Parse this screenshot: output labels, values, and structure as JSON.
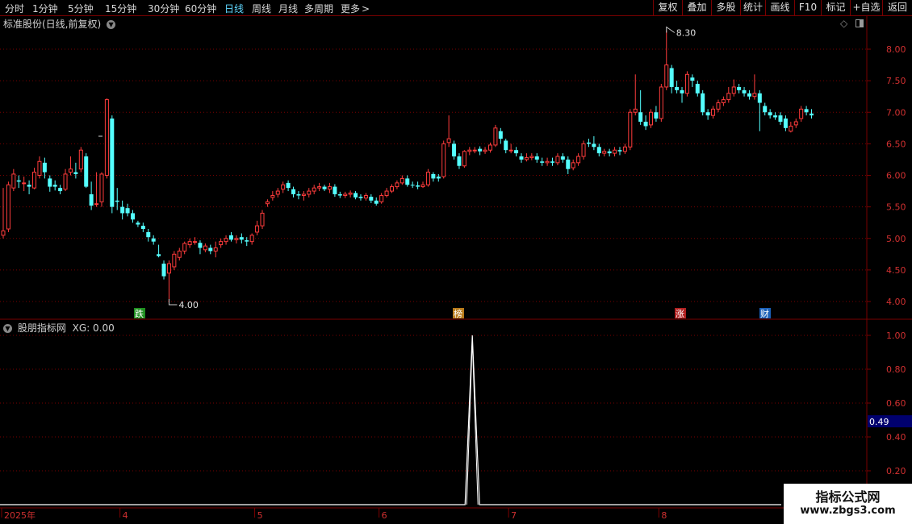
{
  "toolbar": {
    "periods": [
      "分时",
      "1分钟",
      "5分钟",
      "15分钟",
      "30分钟",
      "60分钟",
      "日线",
      "周线",
      "月线",
      "多周期",
      "更多"
    ],
    "active_period": "日线",
    "more_glyph": ">",
    "right_buttons": [
      "复权",
      "叠加",
      "多股",
      "统计",
      "画线",
      "F10",
      "+自选",
      "返回"
    ]
  },
  "main_panel": {
    "title": "标准股份(日线,前复权)",
    "high_marker": "8.30",
    "low_marker": "4.00",
    "event_labels": [
      "跌",
      "榜",
      "涨",
      "财"
    ]
  },
  "indicator_panel": {
    "title": "股朋指标网",
    "xg_label": "XG: 0.00",
    "cursor_value": "0.49"
  },
  "watermark": {
    "title": "指标公式网",
    "url": "www.zbgs3.com"
  },
  "colors": {
    "up": "#ff3c3c",
    "down": "#54ffff",
    "grid": "#7a0000",
    "axis_text": "#d03030",
    "date_text": "#d03030",
    "indicator_line": "#ffffff",
    "cursor_box": "#00006e"
  },
  "chart_data": [
    {
      "type": "candlestick",
      "title": "标准股份(日线,前复权)",
      "y_ticks": [
        "8.00",
        "7.50",
        "7.00",
        "6.50",
        "6.00",
        "5.50",
        "5.00",
        "4.50",
        "4.00"
      ],
      "ylim": [
        3.85,
        8.4
      ],
      "x_ticks": [
        "2025年",
        "4",
        "5",
        "6",
        "7",
        "8"
      ],
      "annotations": {
        "high": 8.3,
        "low": 4.0
      },
      "candles": [
        [
          5.05,
          5.12,
          5.0,
          5.8
        ],
        [
          5.15,
          5.85,
          5.1,
          5.9
        ],
        [
          5.8,
          6.02,
          5.75,
          6.1
        ],
        [
          5.92,
          5.9,
          5.8,
          6.0
        ],
        [
          5.88,
          5.88,
          5.75,
          5.98
        ],
        [
          5.85,
          5.82,
          5.7,
          5.92
        ],
        [
          5.8,
          6.05,
          5.78,
          6.12
        ],
        [
          6.0,
          6.22,
          5.95,
          6.3
        ],
        [
          6.2,
          6.05,
          5.95,
          6.28
        ],
        [
          5.95,
          5.82,
          5.74,
          6.0
        ],
        [
          5.85,
          5.82,
          5.76,
          5.92
        ],
        [
          5.8,
          5.75,
          5.7,
          5.85
        ],
        [
          5.78,
          6.02,
          5.75,
          6.1
        ],
        [
          6.05,
          6.1,
          6.0,
          6.3
        ],
        [
          6.05,
          6.02,
          5.95,
          6.2
        ],
        [
          6.1,
          6.4,
          6.05,
          6.45
        ],
        [
          6.3,
          5.82,
          5.8,
          6.35
        ],
        [
          5.7,
          5.52,
          5.45,
          5.9
        ],
        [
          5.55,
          5.55,
          5.5,
          6.05
        ],
        [
          5.58,
          6.02,
          5.5,
          6.05
        ],
        [
          6.0,
          7.2,
          5.95,
          7.22
        ],
        [
          6.9,
          5.5,
          5.4,
          6.95
        ],
        [
          5.6,
          5.58,
          5.45,
          5.8
        ],
        [
          5.5,
          5.4,
          5.3,
          5.6
        ],
        [
          5.48,
          5.4,
          5.35,
          5.55
        ],
        [
          5.4,
          5.3,
          5.25,
          5.45
        ],
        [
          5.25,
          5.22,
          5.18,
          5.28
        ],
        [
          5.2,
          5.15,
          5.1,
          5.25
        ],
        [
          5.1,
          5.02,
          4.95,
          5.15
        ],
        [
          5.0,
          4.95,
          4.9,
          5.05
        ],
        [
          4.75,
          4.72,
          4.7,
          4.9
        ],
        [
          4.6,
          4.4,
          4.35,
          4.65
        ],
        [
          4.45,
          4.6,
          4.0,
          4.65
        ],
        [
          4.55,
          4.75,
          4.5,
          4.8
        ],
        [
          4.7,
          4.8,
          4.65,
          4.85
        ],
        [
          4.8,
          4.92,
          4.75,
          4.95
        ],
        [
          4.9,
          4.95,
          4.85,
          5.0
        ],
        [
          4.95,
          4.95,
          4.9,
          5.02
        ],
        [
          4.93,
          4.85,
          4.75,
          4.97
        ],
        [
          4.82,
          4.88,
          4.78,
          4.92
        ],
        [
          4.85,
          4.8,
          4.75,
          4.9
        ],
        [
          4.8,
          4.85,
          4.7,
          4.95
        ],
        [
          4.9,
          4.95,
          4.85,
          5.0
        ],
        [
          4.95,
          5.0,
          4.9,
          5.05
        ],
        [
          5.05,
          4.98,
          4.95,
          5.1
        ],
        [
          4.98,
          5.0,
          4.92,
          5.05
        ],
        [
          5.02,
          4.98,
          4.92,
          5.08
        ],
        [
          4.97,
          4.95,
          4.88,
          5.02
        ],
        [
          4.95,
          5.05,
          4.9,
          5.08
        ],
        [
          5.1,
          5.2,
          5.05,
          5.28
        ],
        [
          5.2,
          5.4,
          5.15,
          5.45
        ],
        [
          5.55,
          5.58,
          5.5,
          5.62
        ],
        [
          5.65,
          5.68,
          5.6,
          5.75
        ],
        [
          5.7,
          5.75,
          5.65,
          5.8
        ],
        [
          5.78,
          5.85,
          5.72,
          5.9
        ],
        [
          5.88,
          5.8,
          5.75,
          5.92
        ],
        [
          5.78,
          5.7,
          5.65,
          5.82
        ],
        [
          5.7,
          5.68,
          5.62,
          5.75
        ],
        [
          5.68,
          5.7,
          5.6,
          5.75
        ],
        [
          5.7,
          5.75,
          5.65,
          5.8
        ],
        [
          5.75,
          5.8,
          5.7,
          5.85
        ],
        [
          5.8,
          5.82,
          5.75,
          5.88
        ],
        [
          5.82,
          5.78,
          5.75,
          5.85
        ],
        [
          5.78,
          5.82,
          5.72,
          5.88
        ],
        [
          5.82,
          5.7,
          5.66,
          5.86
        ],
        [
          5.7,
          5.68,
          5.64,
          5.74
        ],
        [
          5.68,
          5.7,
          5.64,
          5.74
        ],
        [
          5.7,
          5.72,
          5.65,
          5.76
        ],
        [
          5.72,
          5.65,
          5.62,
          5.75
        ],
        [
          5.66,
          5.64,
          5.6,
          5.7
        ],
        [
          5.64,
          5.68,
          5.6,
          5.72
        ],
        [
          5.66,
          5.6,
          5.56,
          5.7
        ],
        [
          5.6,
          5.55,
          5.52,
          5.65
        ],
        [
          5.58,
          5.68,
          5.55,
          5.72
        ],
        [
          5.68,
          5.75,
          5.65,
          5.8
        ],
        [
          5.75,
          5.82,
          5.72,
          5.86
        ],
        [
          5.82,
          5.88,
          5.78,
          5.92
        ],
        [
          5.88,
          5.95,
          5.85,
          6.0
        ],
        [
          5.95,
          5.85,
          5.82,
          6.0
        ],
        [
          5.85,
          5.84,
          5.8,
          5.9
        ],
        [
          5.84,
          5.82,
          5.78,
          5.9
        ],
        [
          5.82,
          5.85,
          5.8,
          5.9
        ],
        [
          5.85,
          6.05,
          5.82,
          6.1
        ],
        [
          6.02,
          5.95,
          5.9,
          6.05
        ],
        [
          5.98,
          5.95,
          5.9,
          6.02
        ],
        [
          5.98,
          6.5,
          5.95,
          6.55
        ],
        [
          6.52,
          6.58,
          6.45,
          6.95
        ],
        [
          6.5,
          6.3,
          6.25,
          6.55
        ],
        [
          6.3,
          6.15,
          6.1,
          6.35
        ],
        [
          6.15,
          6.38,
          6.12,
          6.4
        ],
        [
          6.38,
          6.4,
          6.32,
          6.45
        ],
        [
          6.4,
          6.4,
          6.35,
          6.45
        ],
        [
          6.42,
          6.38,
          6.32,
          6.46
        ],
        [
          6.38,
          6.4,
          6.34,
          6.45
        ],
        [
          6.4,
          6.48,
          6.36,
          6.52
        ],
        [
          6.48,
          6.75,
          6.45,
          6.8
        ],
        [
          6.7,
          6.58,
          6.5,
          6.75
        ],
        [
          6.55,
          6.4,
          6.35,
          6.58
        ],
        [
          6.4,
          6.4,
          6.35,
          6.5
        ],
        [
          6.4,
          6.35,
          6.3,
          6.45
        ],
        [
          6.3,
          6.25,
          6.2,
          6.35
        ],
        [
          6.25,
          6.28,
          6.22,
          6.35
        ],
        [
          6.28,
          6.3,
          6.24,
          6.35
        ],
        [
          6.3,
          6.25,
          6.2,
          6.35
        ],
        [
          6.22,
          6.2,
          6.15,
          6.28
        ],
        [
          6.2,
          6.22,
          6.15,
          6.28
        ],
        [
          6.22,
          6.2,
          6.15,
          6.28
        ],
        [
          6.2,
          6.3,
          6.16,
          6.35
        ],
        [
          6.3,
          6.25,
          6.2,
          6.35
        ],
        [
          6.25,
          6.1,
          6.02,
          6.3
        ],
        [
          6.12,
          6.2,
          6.08,
          6.25
        ],
        [
          6.2,
          6.3,
          6.15,
          6.35
        ],
        [
          6.3,
          6.5,
          6.25,
          6.55
        ],
        [
          6.52,
          6.5,
          6.45,
          6.58
        ],
        [
          6.5,
          6.45,
          6.4,
          6.62
        ],
        [
          6.45,
          6.35,
          6.3,
          6.5
        ],
        [
          6.35,
          6.38,
          6.3,
          6.42
        ],
        [
          6.38,
          6.35,
          6.3,
          6.42
        ],
        [
          6.35,
          6.4,
          6.3,
          6.45
        ],
        [
          6.4,
          6.38,
          6.32,
          6.45
        ],
        [
          6.38,
          6.45,
          6.34,
          6.5
        ],
        [
          6.45,
          7.0,
          6.4,
          7.05
        ],
        [
          7.0,
          7.05,
          6.95,
          7.6
        ],
        [
          7.0,
          6.85,
          6.8,
          7.35
        ],
        [
          6.85,
          6.78,
          6.72,
          6.95
        ],
        [
          6.8,
          7.0,
          6.75,
          7.05
        ],
        [
          7.0,
          6.9,
          6.85,
          7.1
        ],
        [
          6.9,
          7.4,
          6.85,
          7.45
        ],
        [
          7.4,
          7.75,
          7.35,
          8.3
        ],
        [
          7.7,
          7.4,
          7.3,
          7.75
        ],
        [
          7.4,
          7.35,
          7.3,
          7.5
        ],
        [
          7.35,
          7.3,
          7.15,
          7.4
        ],
        [
          7.3,
          7.6,
          7.25,
          7.65
        ],
        [
          7.55,
          7.5,
          7.4,
          7.6
        ],
        [
          7.45,
          7.3,
          7.25,
          7.5
        ],
        [
          7.3,
          7.0,
          6.95,
          7.35
        ],
        [
          7.0,
          6.95,
          6.88,
          7.05
        ],
        [
          6.95,
          7.05,
          6.9,
          7.1
        ],
        [
          7.05,
          7.15,
          7.0,
          7.2
        ],
        [
          7.15,
          7.2,
          7.1,
          7.25
        ],
        [
          7.2,
          7.3,
          7.15,
          7.4
        ],
        [
          7.3,
          7.4,
          7.25,
          7.52
        ],
        [
          7.4,
          7.35,
          7.3,
          7.45
        ],
        [
          7.35,
          7.3,
          7.25,
          7.4
        ],
        [
          7.3,
          7.25,
          7.2,
          7.35
        ],
        [
          7.25,
          7.3,
          7.2,
          7.6
        ],
        [
          7.3,
          7.15,
          6.7,
          7.35
        ],
        [
          7.1,
          7.0,
          6.95,
          7.15
        ],
        [
          7.0,
          6.95,
          6.9,
          7.05
        ],
        [
          6.95,
          6.92,
          6.88,
          7.0
        ],
        [
          6.95,
          6.85,
          6.8,
          7.0
        ],
        [
          6.9,
          6.75,
          6.7,
          6.95
        ],
        [
          6.7,
          6.78,
          6.68,
          6.85
        ],
        [
          6.8,
          6.85,
          6.75,
          6.9
        ],
        [
          6.9,
          7.05,
          6.85,
          7.1
        ],
        [
          7.05,
          7.0,
          6.95,
          7.1
        ],
        [
          6.98,
          6.95,
          6.9,
          7.05
        ]
      ]
    },
    {
      "type": "line",
      "title": "股朋指标网",
      "series": [
        {
          "name": "XG",
          "peak_index": 91,
          "peak_value": 1.0,
          "base_value": 0.0
        }
      ],
      "y_ticks": [
        "1.00",
        "0.80",
        "0.60",
        "0.40",
        "0.20"
      ],
      "ylim": [
        -0.05,
        1.05
      ]
    }
  ]
}
